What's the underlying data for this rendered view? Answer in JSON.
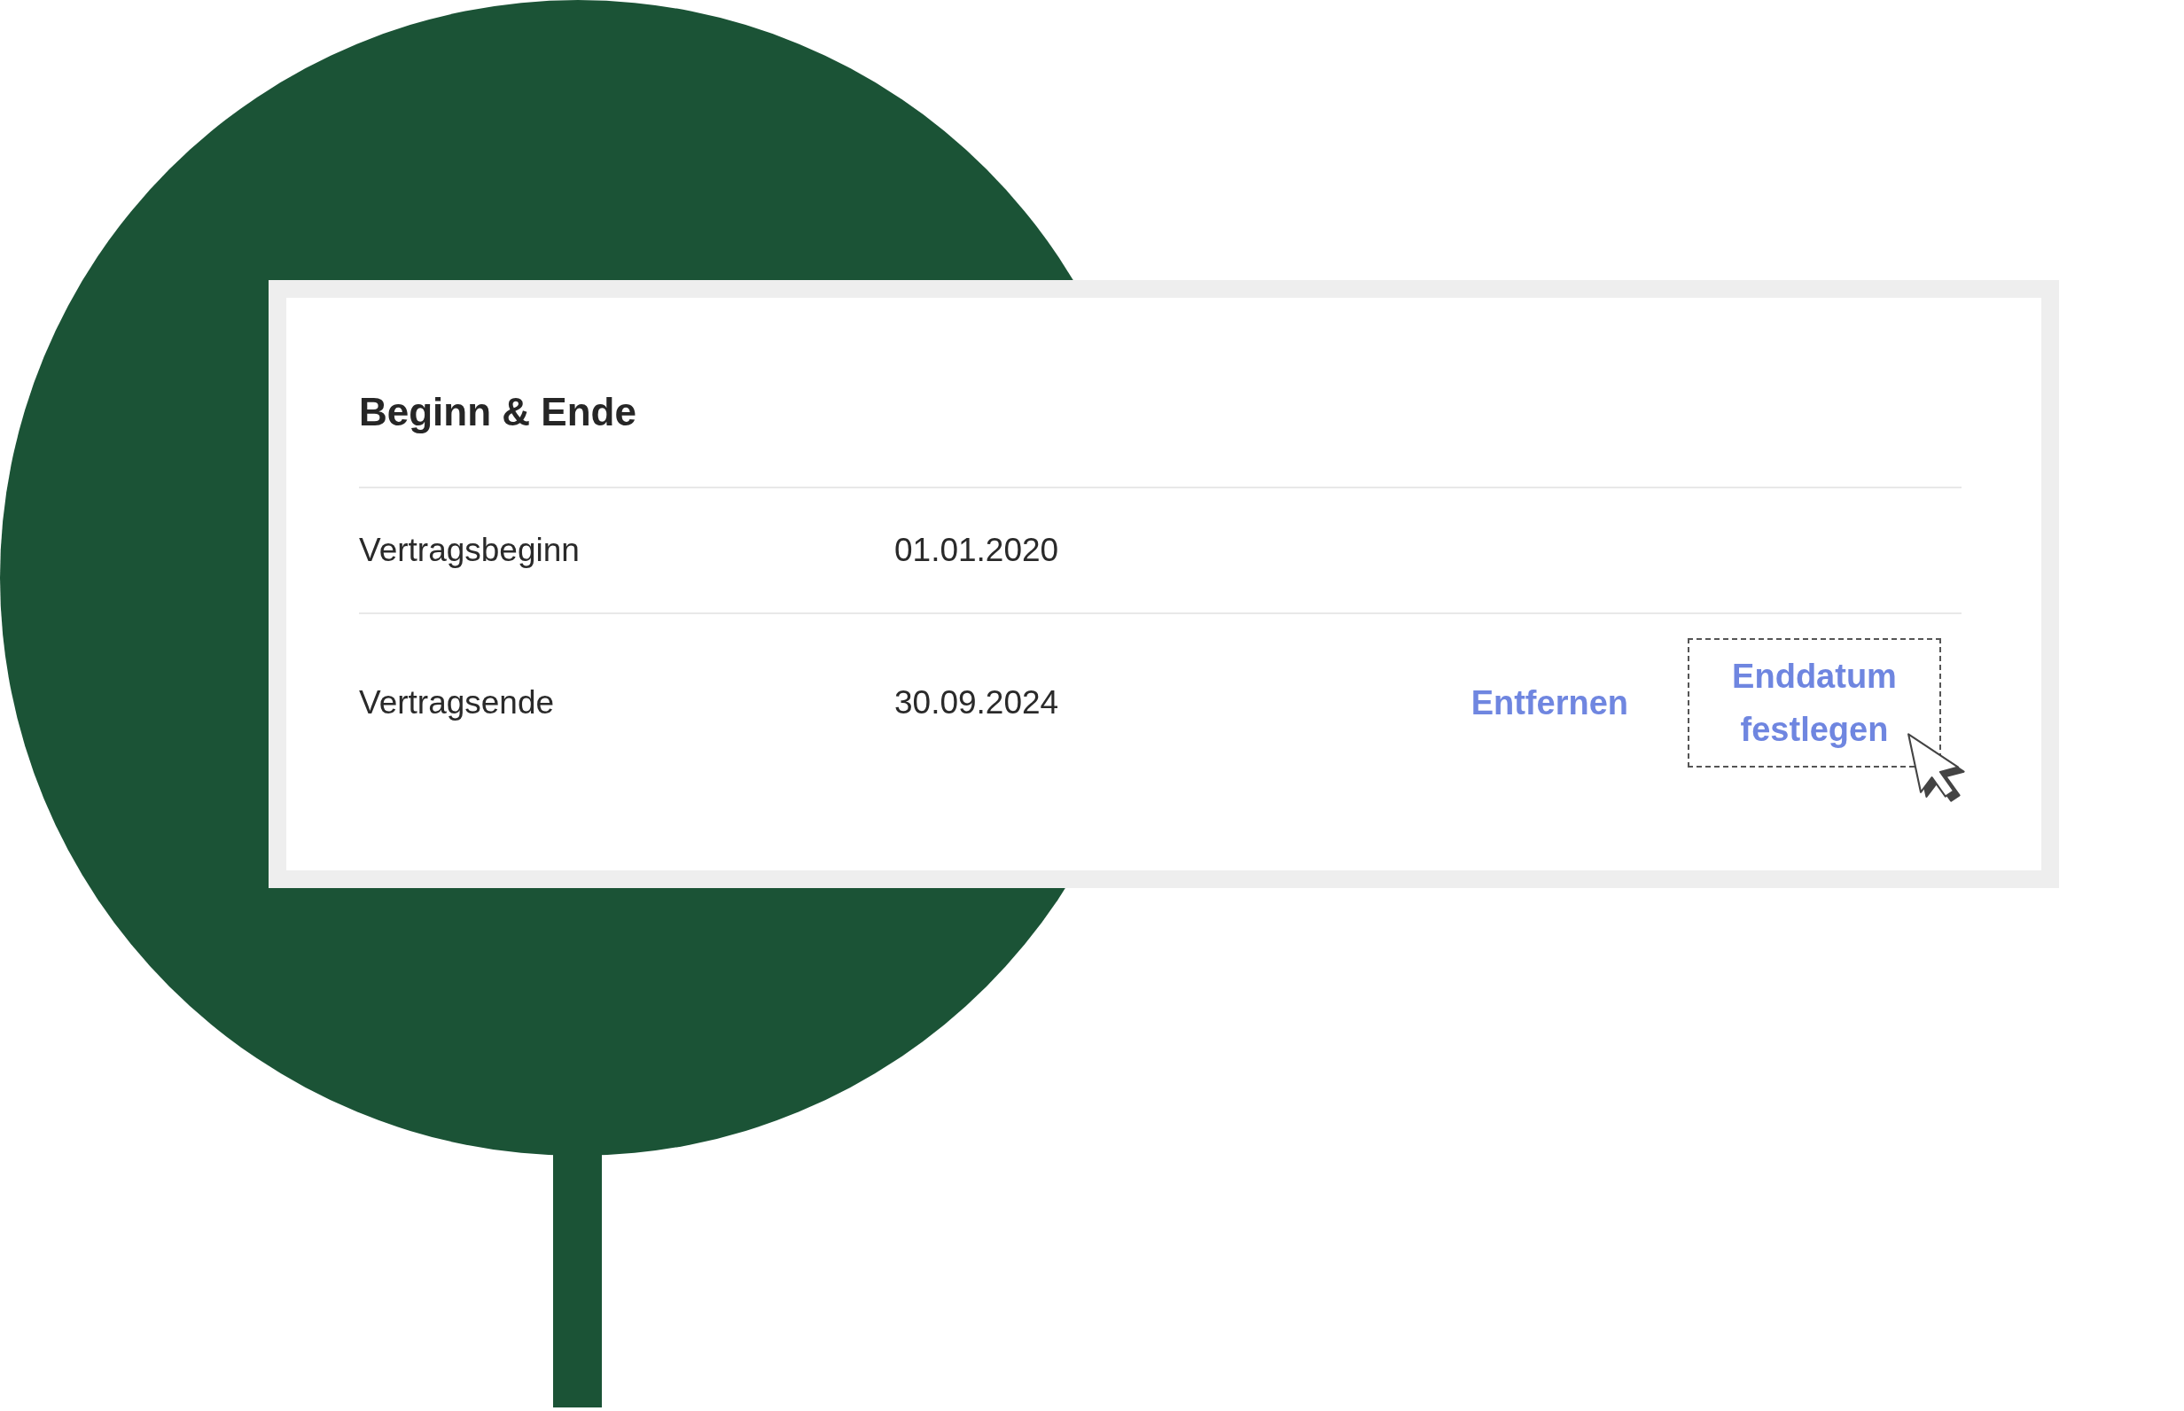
{
  "card": {
    "title": "Beginn & Ende",
    "rows": [
      {
        "label": "Vertragsbeginn",
        "value": "01.01.2020"
      },
      {
        "label": "Vertragsende",
        "value": "30.09.2024",
        "actions": [
          {
            "label": "Entfernen",
            "focused": false
          },
          {
            "label": "Enddatum festlegen",
            "focused": true
          }
        ]
      }
    ]
  }
}
